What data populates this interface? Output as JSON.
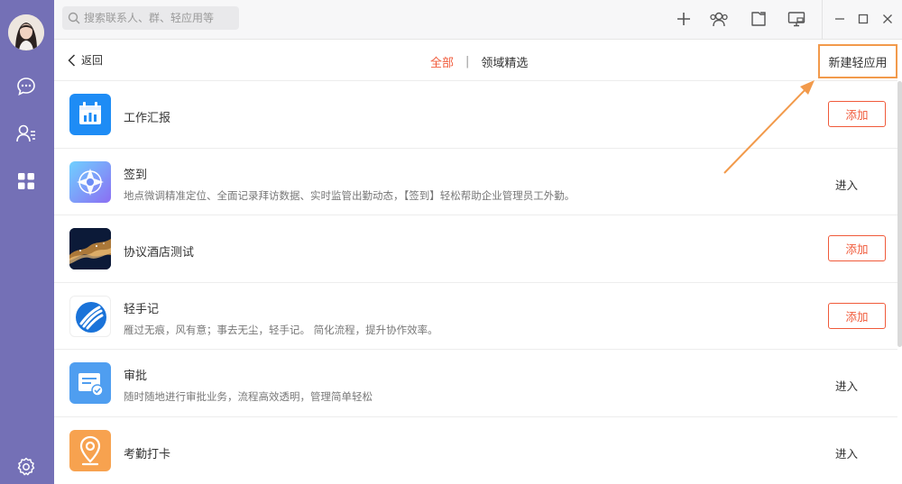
{
  "search": {
    "placeholder": "搜索联系人、群、轻应用等"
  },
  "subheader": {
    "back_label": "返回",
    "tabs": [
      {
        "label": "全部",
        "active": true
      },
      {
        "label": "领域精选",
        "active": false
      }
    ],
    "tab_separator": "|",
    "new_app_label": "新建轻应用"
  },
  "apps": [
    {
      "title": "工作汇报",
      "desc": "",
      "action": "添加",
      "icon": "work-report-icon"
    },
    {
      "title": "签到",
      "desc": "地点微调精准定位、全面记录拜访数据、实时监管出勤动态，【签到】轻松帮助企业管理员工外勤。",
      "action": "进入",
      "icon": "sign-in-icon"
    },
    {
      "title": "协议酒店测试",
      "desc": "",
      "action": "添加",
      "icon": "hotel-photo-icon"
    },
    {
      "title": "轻手记",
      "desc": "雁过无痕，风有意；事去无尘，轻手记。 简化流程，提升协作效率。",
      "action": "添加",
      "icon": "notes-icon"
    },
    {
      "title": "审批",
      "desc": "随时随地进行审批业务，流程高效透明，管理简单轻松",
      "action": "进入",
      "icon": "approval-icon"
    },
    {
      "title": "考勤打卡",
      "desc": "",
      "action": "进入",
      "icon": "location-pin-icon"
    }
  ],
  "colors": {
    "sidebar": "#7470b6",
    "accent": "#f05a3a",
    "annotation": "#f29a4b"
  }
}
